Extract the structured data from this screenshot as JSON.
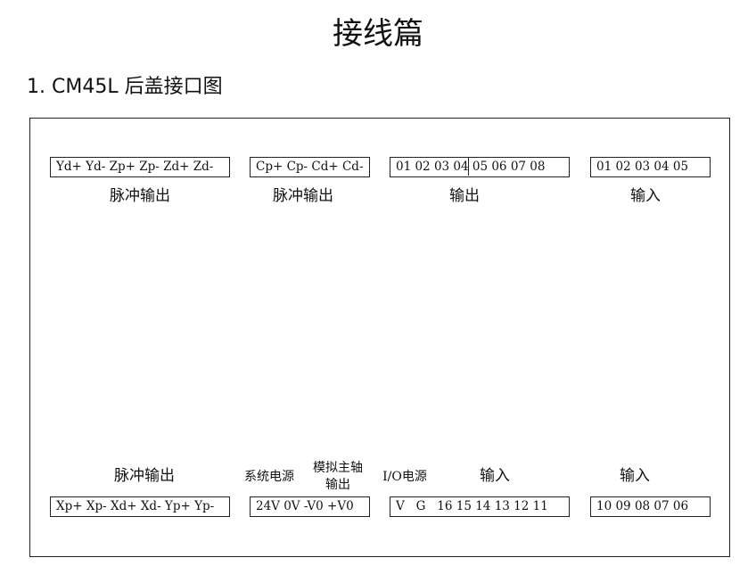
{
  "title": "接线篇",
  "section": {
    "heading": "1.  CM45L 后盖接口图"
  },
  "top_row": {
    "terminals": [
      {
        "pins": "Yd+ Yd- Zp+ Zp- Zd+ Zd-",
        "label": "脉冲输出"
      },
      {
        "pins": "Cp+ Cp- Cd+ Cd-",
        "label": "脉冲输出"
      },
      {
        "pins": "01 02 03 04 05 06 07 08",
        "label": "输出"
      },
      {
        "pins": "01 02 03 04 05",
        "label": "输入"
      }
    ]
  },
  "bottom_row": {
    "labels": {
      "pulse_output": "脉冲输出",
      "system_power": "系统电源",
      "analog_spindle_line1": "模拟主轴",
      "analog_spindle_line2": "输出",
      "io_power": "I/O电源",
      "input_a": "输入",
      "input_b": "输入"
    },
    "terminals": [
      {
        "pins": "Xp+ Xp- Xd+ Xd- Yp+ Yp-"
      },
      {
        "pins": "24V 0V -V0 +V0"
      },
      {
        "pins": "V   G   16 15 14 13 12 11"
      },
      {
        "pins": "10 09 08 07 06"
      }
    ]
  }
}
